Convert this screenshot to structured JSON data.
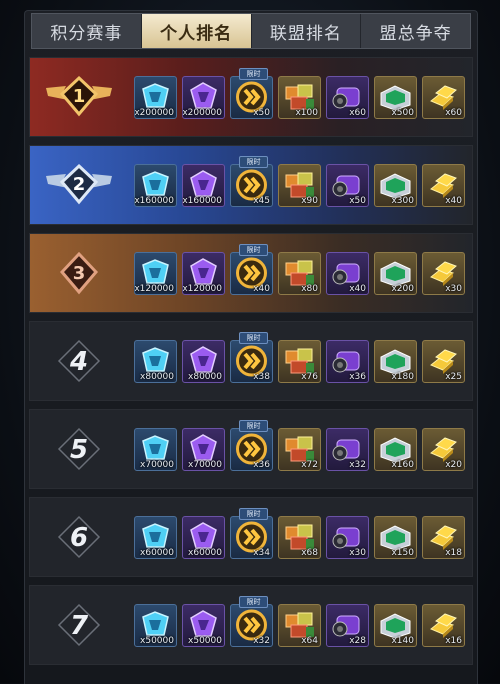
{
  "tabs": [
    {
      "label": "积分赛事",
      "active": false
    },
    {
      "label": "个人排名",
      "active": true
    },
    {
      "label": "联盟排名",
      "active": false
    },
    {
      "label": "盟总争夺",
      "active": false
    }
  ],
  "timed_tag": "限时",
  "rows": [
    {
      "rank": "1",
      "qty": [
        "x200000",
        "x200000",
        "x50",
        "x100",
        "x60",
        "x500",
        "x60"
      ]
    },
    {
      "rank": "2",
      "qty": [
        "x160000",
        "x160000",
        "x45",
        "x90",
        "x50",
        "x300",
        "x40"
      ]
    },
    {
      "rank": "3",
      "qty": [
        "x120000",
        "x120000",
        "x40",
        "x80",
        "x40",
        "x200",
        "x30"
      ]
    },
    {
      "rank": "4",
      "qty": [
        "x80000",
        "x80000",
        "x38",
        "x76",
        "x36",
        "x180",
        "x25"
      ]
    },
    {
      "rank": "5",
      "qty": [
        "x70000",
        "x70000",
        "x36",
        "x72",
        "x32",
        "x160",
        "x20"
      ]
    },
    {
      "rank": "6",
      "qty": [
        "x60000",
        "x60000",
        "x34",
        "x68",
        "x30",
        "x150",
        "x18"
      ]
    },
    {
      "rank": "7",
      "qty": [
        "x50000",
        "x50000",
        "x32",
        "x64",
        "x28",
        "x140",
        "x16"
      ]
    }
  ],
  "item_icons": [
    "cyan-crystal-icon",
    "purple-crystal-icon",
    "speed-boost-icon",
    "supply-crates-icon",
    "purple-engine-icon",
    "green-chest-icon",
    "gold-bars-icon"
  ],
  "colors": {
    "gold_tab": "#e6d6ab",
    "rank1": "#8e2a22",
    "rank2": "#3a64c4",
    "rank3": "#9a6030"
  }
}
